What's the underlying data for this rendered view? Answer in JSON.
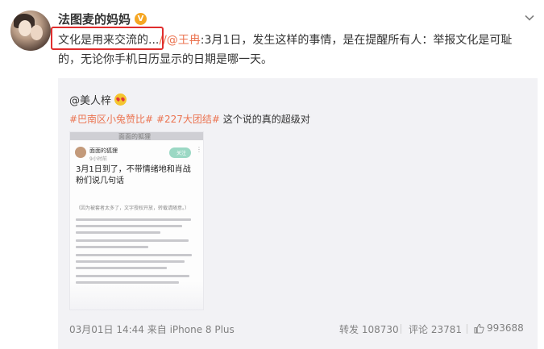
{
  "post": {
    "author": "法图麦的妈妈",
    "verified_badge": "V",
    "text_highlighted": "文化是用来交流的...",
    "text_mention": "//@王冉",
    "text_rest": ":3月1日，发生这样的事情，是在提醒所有人：举报文化是可耻的，无论你手机日历显示的日期是哪一天。"
  },
  "repost": {
    "author": "@美人梓",
    "tag1": "#巴南区小兔赞比#",
    "tag2": "#227大团结#",
    "text": "这个说的真的超级对",
    "footer": {
      "time_source": "03月01日 14:44 来自 iPhone 8 Plus",
      "repost": "转发 108730",
      "comment": "评论 23781",
      "like": "993688"
    }
  },
  "image": {
    "top_label": "面面的狐狸",
    "name": "面面的狐狸",
    "sub": "9小时前",
    "follow": "关注",
    "title": "3月1日到了，不带情绪地和肖战粉们说几句话",
    "note": "（因为被套者太多了，文字授权开放，转载请随意。）"
  },
  "icons": {
    "chevron": "chevron-down-icon",
    "like": "thumbs-up-icon",
    "emoji": "heart-eyes-emoji-icon"
  },
  "colors": {
    "highlight_border": "#e02d2d",
    "link": "#eb7350",
    "badge": "#f5a623"
  }
}
